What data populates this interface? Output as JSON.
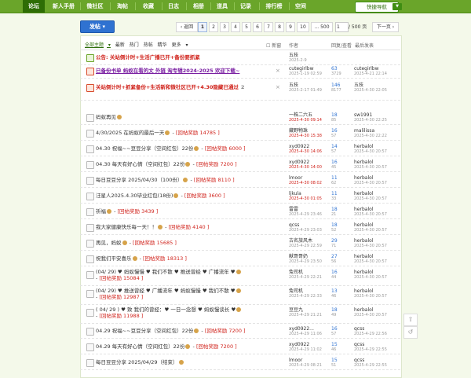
{
  "nav": {
    "items": [
      "论坛",
      "新人手册",
      "微社区",
      "淘帖",
      "收藏",
      "日志",
      "相册",
      "道具",
      "记录",
      "排行榜",
      "空间"
    ],
    "quicknav": "快捷导航"
  },
  "toolbar": {
    "post": "发帖",
    "prev": "返回",
    "pages": [
      "1",
      "2",
      "3",
      "4",
      "5",
      "6",
      "7",
      "8",
      "9",
      "10",
      "... 500"
    ],
    "page_input": "1",
    "total": "/ 500 页",
    "next": "下一页"
  },
  "filter": {
    "items": [
      "全部主题",
      "最新",
      "热门",
      "热帖",
      "精华",
      "更多"
    ],
    "new_window": "新窗",
    "author": "作者",
    "replies": "回复/查看",
    "last": "最后发表"
  },
  "threads": [
    {
      "type": "notice",
      "title": "公告: 关站倒计时+生活广播已开+备份要抓紧",
      "author": "五技",
      "adate": "2025-2-9",
      "rep": "",
      "views": "",
      "last": "",
      "ldate": "",
      "style": "red"
    },
    {
      "type": "pin",
      "title": "已备份书单 蚂蚁在看的文 外链 淘专辑2024-2025 欢迎下载~",
      "author": "cutegirlbw",
      "adate": "2025-1-19 02:59",
      "rep": "63",
      "views": "3729",
      "last": "cutegirlbw",
      "ldate": "2025-4-21 22:14",
      "style": "purple"
    },
    {
      "type": "pin",
      "title": "关站倒计时+抓紧备份+生活新和微社区已开+4.30隐藏已通过",
      "title2": "2",
      "author": "五技",
      "adate": "2025-2-17 01:49",
      "rep": "146",
      "views": "8177",
      "last": "五技",
      "ldate": "2025-4-30 22:05",
      "style": "red2"
    },
    {
      "type": "n",
      "title": "蚂蚁再见",
      "reward": "",
      "author": "一株二六五",
      "adate": "2025-4-30 09:14",
      "rep": "18",
      "views": "85",
      "last": "sw1991",
      "ldate": "2025-4-30 22:25",
      "dnew": true
    },
    {
      "type": "n",
      "title": "4/30/2025 在蚂蚁的最后一天",
      "reward": "[回帖奖励 14785 ]",
      "author": "藏野物珠",
      "adate": "2025-4-30 15:38",
      "rep": "16",
      "views": "57",
      "last": "malilissa",
      "ldate": "2025-4-30 22:22",
      "dnew": true
    },
    {
      "type": "n",
      "title": "04.30 祝福~~豆豆分享（空间红包）22份",
      "reward": "[回帖奖励 6000 ]",
      "author": "xyd0922",
      "adate": "2025-4-30 14:06",
      "rep": "14",
      "views": "57",
      "last": "herbalol",
      "ldate": "2025-4-30 20:57",
      "dnew": true
    },
    {
      "type": "n",
      "title": "04.30 每天有好心情（空间红包）22份",
      "reward": "[回帖奖励 7200 ]",
      "author": "xyd0922",
      "adate": "2025-4-30 14:00",
      "rep": "16",
      "views": "45",
      "last": "herbalol",
      "ldate": "2025-4-30 20:57",
      "dnew": true
    },
    {
      "type": "n",
      "title": "每日豆豆分享 2025/04/30（100份）",
      "reward": "[回帖奖励 8110 ]",
      "author": "lmoor",
      "adate": "2025-4-30 08:02",
      "rep": "11",
      "views": "62",
      "last": "herbalol",
      "ldate": "2025-4-30 20:57",
      "dnew": true
    },
    {
      "type": "n",
      "title": "汪星人2025.4.30毕业红包(18份)",
      "reward": "[回帖奖励 3600 ]",
      "author": "ljkula",
      "adate": "2025-4-30 01:05",
      "rep": "11",
      "views": "33",
      "last": "herbalol",
      "ldate": "2025-4-30 20:57",
      "dnew": true
    },
    {
      "type": "n",
      "title": "祈福",
      "reward": "[回帖奖励 3439 ]",
      "author": "雷雷",
      "adate": "2025-4-29 23:46",
      "rep": "18",
      "views": "21",
      "last": "herbalol",
      "ldate": "2025-4-30 20:57"
    },
    {
      "type": "n",
      "title": "我大家健康快乐每一天！！",
      "reward": "[回帖奖励 4140 ]",
      "author": "qcss",
      "adate": "2025-4-29 23:03",
      "rep": "18",
      "views": "52",
      "last": "herbalol",
      "ldate": "2025-4-30 20:57"
    },
    {
      "type": "n",
      "title": "再见，蚂蚁",
      "reward": "[回帖奖励 15685 ]",
      "author": "古名旅风木",
      "adate": "2025-4-29 22:59",
      "rep": "29",
      "views": "71",
      "last": "herbalol",
      "ldate": "2025-4-30 20:57"
    },
    {
      "type": "n",
      "title": "祝我们平安喜乐",
      "reward": "[回帖奖励 18313 ]",
      "author": "献哥哥奶",
      "adate": "2025-4-29 23:50",
      "rep": "27",
      "views": "56",
      "last": "herbalol",
      "ldate": "2025-4-30 20:57"
    },
    {
      "type": "n2",
      "title": "(04/ 29) ♥ 蚂蚁慢慢 ♥ 我们不散 ♥ 推送曾经 ♥ 广播流年 ♥",
      "reward": "[回帖奖励 15084 ]",
      "author": "兔司机",
      "adate": "2025-4-29 22:21",
      "rep": "16",
      "views": "44",
      "last": "herbalol",
      "ldate": "2025-4-30 20:57"
    },
    {
      "type": "n2",
      "title": "(04/ 29) ♥ 推送曾经 ♥ 广播流年 ♥ 蚂蚁慢慢 ♥ 我们不散 ♥",
      "reward": "[回帖奖励 12987 ]",
      "author": "兔司机",
      "adate": "2025-4-29 22:33",
      "rep": "13",
      "views": "46",
      "last": "herbalol",
      "ldate": "2025-4-30 20:57"
    },
    {
      "type": "n2",
      "title": "( 04/ 29 ) ♥ 致 我们的曾经：♥ 一日一念想 ♥ 蚂蚁慢谈长 ♥",
      "reward": "[回帖奖励 11988 ]",
      "author": "豆豆九",
      "adate": "2025-4-29 21:21",
      "rep": "18",
      "views": "49",
      "last": "herbalol",
      "ldate": "2025-4-30 20:57"
    },
    {
      "type": "n",
      "title": "04.29 祝福~~豆豆分享（空间红包）22份",
      "reward": "[回帖奖励 7200 ]",
      "author": "xyd0922...",
      "adate": "2025-4-29 11:06",
      "rep": "16",
      "views": "57",
      "last": "qcss",
      "ldate": "2025-4-29 22:56"
    },
    {
      "type": "n",
      "title": "04.29 每天有好心情（空间红包）22份",
      "reward": "[回帖奖励 7200 ]",
      "author": "xyd0922",
      "adate": "2025-4-29 11:02",
      "rep": "15",
      "views": "46",
      "last": "qcss",
      "ldate": "2025-4-29 22:55"
    },
    {
      "type": "n",
      "title": "每日豆豆分享 2025/04/29（结束）",
      "reward": "",
      "author": "lmoor",
      "adate": "2025-4-29 08:21",
      "rep": "15",
      "views": "51",
      "last": "qcss",
      "ldate": "2025-4-29 22:55"
    }
  ],
  "colors": {
    "nav": "#6aa52a",
    "nav_active": "#2e6d05",
    "accent": "#d0231c",
    "link": "#2f72d1"
  }
}
